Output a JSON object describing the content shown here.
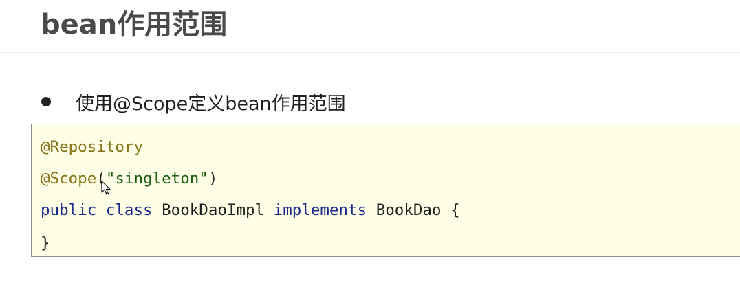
{
  "page": {
    "title": "bean作用范围"
  },
  "bullets": [
    {
      "text": "使用@Scope定义bean作用范围"
    }
  ],
  "code": {
    "line1": {
      "annotation": "@Repository"
    },
    "line2": {
      "annotation": "@Scope",
      "open_paren": "(",
      "string": "\"singleton\"",
      "close_paren": ")"
    },
    "line3": {
      "kw_public": "public",
      "kw_class": "class",
      "class_name": "BookDaoImpl",
      "kw_implements": "implements",
      "interface_name": "BookDao",
      "brace_open": "{"
    },
    "line4": {
      "brace_close": "}"
    }
  },
  "colors": {
    "annotation": "#857215",
    "string": "#1d5f10",
    "keyword": "#1a2a8a",
    "code_background": "#fefee6",
    "title": "#4a4a4a"
  },
  "icons": {
    "cursor": "mouse-pointer-icon"
  }
}
